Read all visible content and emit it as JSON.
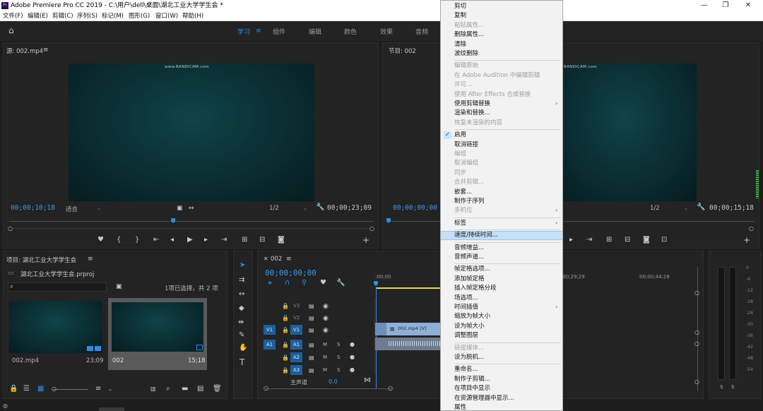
{
  "window": {
    "title": "Adobe Premiere Pro CC 2019 - C:\\用户\\dell\\桌面\\湖北工业大学学生会 *",
    "logo_text": "Pr"
  },
  "menu": [
    "文件(F)",
    "编辑(E)",
    "剪辑(C)",
    "序列(S)",
    "标记(M)",
    "图形(G)",
    "窗口(W)",
    "帮助(H)"
  ],
  "workspaces": {
    "items": [
      "学习",
      "组件",
      "编辑",
      "颜色",
      "效果",
      "音频"
    ],
    "active": "学习"
  },
  "source_monitor": {
    "title": "源: 002.mp4",
    "timecode": "00;00;10;18",
    "fit": "适合",
    "resolution": "1/2",
    "duration": "00;00;23;09",
    "watermark": "www.BANDICAM.com",
    "playhead_fraction": 0.45
  },
  "program_monitor": {
    "title": "节目: 002",
    "timecode": "00;00;00;00",
    "resolution": "1/2",
    "duration": "00;00;15;18",
    "watermark": "www.BANDICAM.com",
    "playhead_fraction": 0.0
  },
  "project": {
    "title": "项目: 湖北工业大学学生会",
    "file": "湖北工业大学学生会.prproj",
    "selection": "1项已选择，共 2 项",
    "items": [
      {
        "name": "002.mp4",
        "duration": "23;09"
      },
      {
        "name": "002",
        "duration": "15;18"
      }
    ]
  },
  "timeline": {
    "tab": "002",
    "timecode": "00;00;00;00",
    "ruler": [
      ":00;00",
      "00;00;29;29",
      "00;00;44;28"
    ],
    "video_tracks": [
      "V3",
      "V2",
      "V1"
    ],
    "audio_tracks": [
      "A1",
      "A2",
      "A3"
    ],
    "source_v1": "V1",
    "source_a1": "A1",
    "clip_label": "002.mp4 [V]",
    "master": "主声道",
    "master_value": "0.0",
    "mute": "M",
    "solo": "S"
  },
  "audio_meter": {
    "scale": [
      "0",
      "-6",
      "-12",
      "-18",
      "-24",
      "-30",
      "-36",
      "-42",
      "-48",
      "-54"
    ],
    "buttons": [
      "S",
      "S"
    ]
  },
  "context_menu": {
    "highlighted": "速度/持续时间...",
    "items": [
      {
        "label": "剪切",
        "disabled": false
      },
      {
        "label": "复制",
        "disabled": false
      },
      {
        "label": "粘贴属性...",
        "disabled": true
      },
      {
        "label": "删除属性...",
        "disabled": false
      },
      {
        "label": "清除",
        "disabled": false
      },
      {
        "label": "波纹删除",
        "disabled": false
      },
      {
        "sep": true
      },
      {
        "label": "编辑原始",
        "disabled": true
      },
      {
        "label": "在 Adobe Audition 中编辑剪辑",
        "disabled": true
      },
      {
        "label": "许可...",
        "disabled": true
      },
      {
        "label": "使用 After Effects 合成替换",
        "disabled": true
      },
      {
        "label": "使用剪辑替换",
        "disabled": false,
        "submenu": true
      },
      {
        "label": "渲染和替换...",
        "disabled": false
      },
      {
        "label": "恢复未渲染的内容",
        "disabled": true
      },
      {
        "sep": true
      },
      {
        "label": "启用",
        "disabled": false,
        "checked": true
      },
      {
        "label": "取消链接",
        "disabled": false
      },
      {
        "label": "编组",
        "disabled": true
      },
      {
        "label": "取消编组",
        "disabled": true
      },
      {
        "label": "同步",
        "disabled": true
      },
      {
        "label": "合并剪辑...",
        "disabled": true
      },
      {
        "label": "嵌套...",
        "disabled": false
      },
      {
        "label": "制作子序列",
        "disabled": false
      },
      {
        "label": "多机位",
        "disabled": true,
        "submenu": true
      },
      {
        "sep": true
      },
      {
        "label": "标签",
        "disabled": false,
        "submenu": true
      },
      {
        "sep": true
      },
      {
        "label": "速度/持续时间...",
        "disabled": false
      },
      {
        "sep": true
      },
      {
        "label": "音频增益...",
        "disabled": false
      },
      {
        "label": "音频声道...",
        "disabled": false
      },
      {
        "sep": true
      },
      {
        "label": "帧定格选项...",
        "disabled": false
      },
      {
        "label": "添加帧定格",
        "disabled": false
      },
      {
        "label": "插入帧定格分段",
        "disabled": false
      },
      {
        "label": "场选项...",
        "disabled": false
      },
      {
        "label": "时间插值",
        "disabled": false,
        "submenu": true
      },
      {
        "label": "缩放为帧大小",
        "disabled": false
      },
      {
        "label": "设为帧大小",
        "disabled": false
      },
      {
        "label": "调整图层",
        "disabled": false
      },
      {
        "sep": true
      },
      {
        "label": "链接媒体...",
        "disabled": true
      },
      {
        "label": "设为脱机...",
        "disabled": false
      },
      {
        "sep": true
      },
      {
        "label": "重命名...",
        "disabled": false
      },
      {
        "label": "制作子剪辑...",
        "disabled": false
      },
      {
        "label": "在项目中显示",
        "disabled": false
      },
      {
        "label": "在资源管理器中显示...",
        "disabled": false
      },
      {
        "label": "属性",
        "disabled": false
      }
    ]
  }
}
